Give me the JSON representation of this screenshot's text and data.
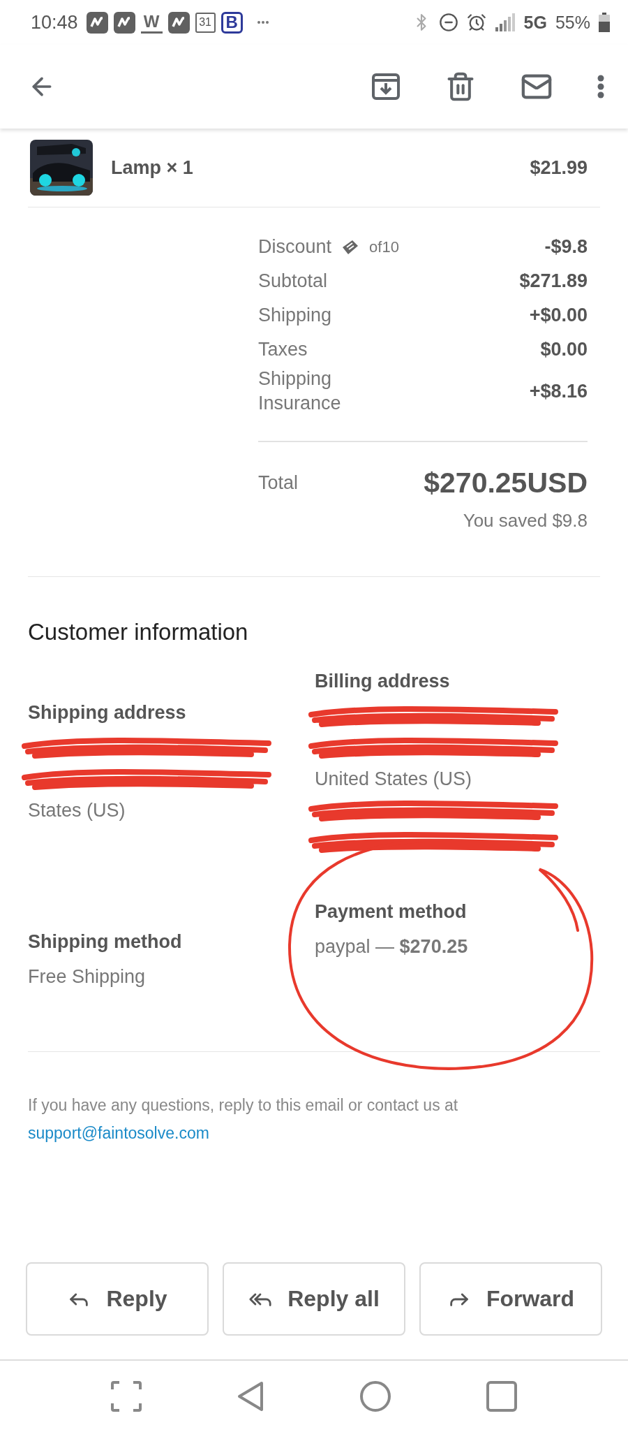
{
  "status_bar": {
    "time": "10:48",
    "notifications": [
      {
        "kind": "app"
      },
      {
        "kind": "app"
      },
      {
        "kind": "letter",
        "label": "W"
      },
      {
        "kind": "app"
      },
      {
        "kind": "calendar",
        "label": "31"
      },
      {
        "kind": "badge",
        "label": "B"
      },
      {
        "kind": "more"
      }
    ],
    "network": "5G",
    "battery": "55%"
  },
  "product": {
    "name": "Lamp × 1",
    "price": "$21.99"
  },
  "totals": [
    {
      "label": "Discount",
      "coupon": "of10",
      "value": "-$9.8"
    },
    {
      "label": "Subtotal",
      "value": "$271.89"
    },
    {
      "label": "Shipping",
      "value": "+$0.00"
    },
    {
      "label": "Taxes",
      "value": "$0.00"
    },
    {
      "label": "Shipping Insurance",
      "value": "+$8.16"
    }
  ],
  "total": {
    "label": "Total",
    "value": "$270.25USD",
    "saved": "You saved $9.8"
  },
  "customer": {
    "title": "Customer information",
    "shipping_address": {
      "heading": "Shipping address",
      "lines": [
        {
          "kind": "redacted"
        },
        {
          "kind": "redacted"
        },
        {
          "kind": "text",
          "text": "States (US)"
        }
      ]
    },
    "billing_address": {
      "heading": "Billing address",
      "lines": [
        {
          "kind": "redacted"
        },
        {
          "kind": "redacted"
        },
        {
          "kind": "text",
          "text": "United States (US)"
        },
        {
          "kind": "redacted"
        },
        {
          "kind": "redacted"
        }
      ]
    },
    "shipping_method": {
      "heading": "Shipping method",
      "text": "Free Shipping"
    },
    "payment_method": {
      "heading": "Payment method",
      "text": "paypal — **$270.25**",
      "circled": true
    }
  },
  "footer": {
    "text": "If you have any questions, reply to this email or contact us at",
    "link": "support@faintosolve.com"
  },
  "actions": [
    {
      "kind": "reply",
      "label": "Reply"
    },
    {
      "kind": "reply_all",
      "label": "Reply all"
    },
    {
      "kind": "forward",
      "label": "Forward"
    }
  ]
}
